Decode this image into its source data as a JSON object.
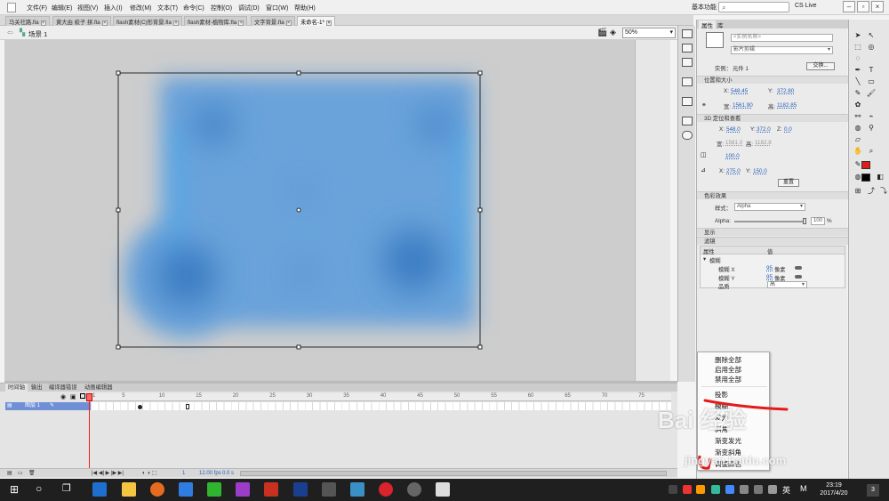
{
  "menubar": {
    "items": [
      "文件(F)",
      "编辑(E)",
      "视图(V)",
      "插入(I)",
      "修改(M)",
      "文本(T)",
      "命令(C)",
      "控制(O)",
      "调试(D)",
      "窗口(W)",
      "帮助(H)"
    ],
    "workspace": "基本功能 ▾",
    "cs_live": "CS Live"
  },
  "doc_tabs": [
    "马关社路.fla",
    "黄大由 蛟子 拼.fla",
    "flash素材(C)形背景.fla",
    "flash素材-植物库.fla",
    "文字背景.fla",
    "未命名-1*"
  ],
  "scene": {
    "label": "场景 1",
    "zoom": "50%"
  },
  "properties": {
    "tabs": [
      "属性",
      "库"
    ],
    "instance_name_placeholder": "<实例名称>",
    "symbol_type": "影片剪辑",
    "instance_of_label": "实例：",
    "instance_of_value": "元件 1",
    "swap_button": "交换...",
    "sections": {
      "position": "位置和大小",
      "transform3d": "3D 定位和查看",
      "color": "色彩效果",
      "display": "显示",
      "filters": "滤镜"
    },
    "x_label": "X:",
    "x_value": "548.45",
    "y_label": "Y:",
    "y_value": "372.80",
    "w_label": "宽:",
    "w_value": "1561.90",
    "h_label": "高:",
    "h_value": "1182.85",
    "x3d": "548.0",
    "y3d": "372.0",
    "z3d": "0.0",
    "w3d": "1561.0",
    "h3d": "1182.8",
    "persp": "100.0",
    "vx": "275.0",
    "vy": "150.0",
    "reset_button": "重置",
    "style_label": "样式：",
    "style_value": "Alpha",
    "alpha_label": "Alpha:",
    "alpha_value": "100",
    "alpha_unit": "%",
    "filter_col_property": "属性",
    "filter_col_value": "值",
    "filter_name": "模糊",
    "blur_x_label": "模糊 X",
    "blur_x_value": "95",
    "blur_x_unit": "像素",
    "blur_y_label": "模糊 Y",
    "blur_y_value": "95",
    "blur_y_unit": "像素",
    "quality_label": "品质",
    "quality_value": "高"
  },
  "timeline": {
    "tabs": [
      "时间轴",
      "输出",
      "编译器错误",
      "动画编辑器"
    ],
    "ticks": [
      "1",
      "5",
      "10",
      "15",
      "20",
      "25",
      "30",
      "35",
      "40",
      "45",
      "50",
      "55",
      "60",
      "65",
      "70",
      "75"
    ],
    "layer_name": "图层 1",
    "fps": "12.00 fps",
    "time": "0.0 s",
    "frame": "1"
  },
  "context_menu": {
    "items": [
      "删除全部",
      "启用全部",
      "禁用全部",
      "投影",
      "模糊",
      "发光",
      "斜角",
      "渐变发光",
      "渐变斜角",
      "调整颜色"
    ]
  },
  "taskbar": {
    "ime": "英",
    "ime2": "M",
    "time": "23:19",
    "date": "2017/4/20",
    "notify_count": "3"
  },
  "watermark": {
    "text": "Bai 经验",
    "url": "jingyan.baidu.com"
  },
  "colors": {
    "stage_gray": "#cdcdcd",
    "blur_blue": "#5c98d4",
    "accent_red": "#e41b1b",
    "selection": "#6f8fd6"
  }
}
